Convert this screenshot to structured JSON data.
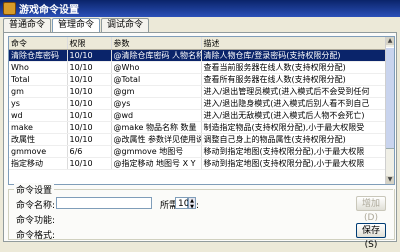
{
  "window": {
    "title": "游戏命令设置",
    "icon": "app-icon"
  },
  "tabs": [
    {
      "label": "普通命令",
      "active": false
    },
    {
      "label": "管理命令",
      "active": true
    },
    {
      "label": "调试命令",
      "active": false
    }
  ],
  "table": {
    "columns": [
      "命令",
      "权限",
      "参数",
      "描述"
    ],
    "rows": [
      [
        "清除仓库密码",
        "10/10",
        "@清除仓库密码 人物名称",
        "清除人物仓库/登录密码(支持权限分配)"
      ],
      [
        "Who",
        "10/10",
        "@Who",
        "查看当前服务器在线人数(支持权限分配)"
      ],
      [
        "Total",
        "10/10",
        "@Total",
        "查看所有服务器在线人数(支持权限分配)"
      ],
      [
        "gm",
        "10/10",
        "@gm",
        "进入/退出管理员模式(进入模式后不会受到任何"
      ],
      [
        "ys",
        "10/10",
        "@ys",
        "进入/退出隐身模式(进入模式后别人看不到自己"
      ],
      [
        "wd",
        "10/10",
        "@wd",
        "进入/退出无敌模式(进入模式后人物不会死亡)"
      ],
      [
        "make",
        "10/10",
        "@make 物品名称 数量",
        "制造指定物品(支持权限分配),小于最大权限受"
      ],
      [
        "改属性",
        "10/10",
        "@改属性 参数详见使用说明",
        "调整自己身上的物品属性(支持权限分配)"
      ],
      [
        "gmmove",
        "6/6",
        "@gmmove 地图号",
        "移动到指定地图(支持权限分配),小于最大权限"
      ],
      [
        "指定移动",
        "10/10",
        "@指定移动 地图号 X Y",
        "移动到指定地图(支持权限分配),小于最大权限"
      ]
    ],
    "selected_row": 0
  },
  "settings": {
    "group_label": "命令设置",
    "name_label": "命令名称:",
    "name_value": "",
    "level_label": "所需权限:",
    "level_value": "10",
    "function_label": "命令功能:",
    "format_label": "命令格式:",
    "add_button": "增加(D)",
    "save_button": "保存(S)"
  }
}
